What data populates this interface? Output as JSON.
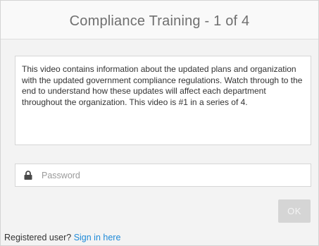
{
  "dialog": {
    "title": "Compliance Training - 1 of 4",
    "description": "This video contains information about the updated plans and organization with the updated government compliance regulations. Watch through to the end to understand how these updates will affect each department throughout the organization.  This video is #1 in a series of 4."
  },
  "password": {
    "icon": "lock-icon",
    "placeholder": "Password",
    "value": ""
  },
  "ok_button": {
    "label": "OK"
  },
  "footer": {
    "prompt": "Registered user?",
    "link_label": "Sign in here"
  },
  "colors": {
    "link": "#1f8ad8",
    "button_disabled": "#d5d5d5",
    "panel_background": "#f3f3f3"
  }
}
